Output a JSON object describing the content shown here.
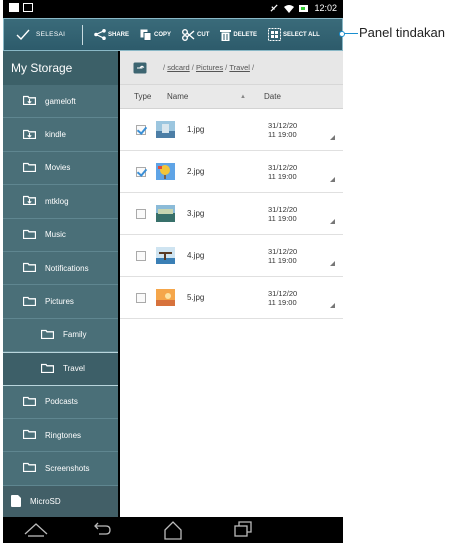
{
  "status_bar": {
    "time": "12:02"
  },
  "action_bar": {
    "done_label": "SELESAI",
    "share_label": "SHARE",
    "copy_label": "COPY",
    "cut_label": "CUT",
    "delete_label": "DELETE",
    "select_all_label": "SELECT ALL"
  },
  "sidebar": {
    "title": "My Storage",
    "items": [
      {
        "label": "gameloft",
        "icon": "folder-download-icon"
      },
      {
        "label": "kindle",
        "icon": "folder-download-icon"
      },
      {
        "label": "Movies",
        "icon": "folder-icon"
      },
      {
        "label": "mtklog",
        "icon": "folder-download-icon"
      },
      {
        "label": "Music",
        "icon": "folder-icon"
      },
      {
        "label": "Notifications",
        "icon": "folder-icon"
      },
      {
        "label": "Pictures",
        "icon": "folder-icon"
      },
      {
        "label": "Family",
        "icon": "folder-icon"
      },
      {
        "label": "Travel",
        "icon": "folder-icon"
      },
      {
        "label": "Podcasts",
        "icon": "folder-icon"
      },
      {
        "label": "Ringtones",
        "icon": "folder-icon"
      },
      {
        "label": "Screenshots",
        "icon": "folder-icon"
      },
      {
        "label": "MicroSD",
        "icon": "sdcard-icon"
      }
    ]
  },
  "path": {
    "root": "/",
    "sdcard": "sdcard",
    "sep1": "/",
    "pictures": "Pictures",
    "sep2": "/",
    "travel": "Travel",
    "end": "/"
  },
  "columns": {
    "type": "Type",
    "name": "Name",
    "date": "Date"
  },
  "files": [
    {
      "name": "1.jpg",
      "date1": "31/12/20",
      "date2": "11 19:00",
      "checked": true
    },
    {
      "name": "2.jpg",
      "date1": "31/12/20",
      "date2": "11 19:00",
      "checked": true
    },
    {
      "name": "3.jpg",
      "date1": "31/12/20",
      "date2": "11 19:00",
      "checked": false
    },
    {
      "name": "4.jpg",
      "date1": "31/12/20",
      "date2": "11 19:00",
      "checked": false
    },
    {
      "name": "5.jpg",
      "date1": "31/12/20",
      "date2": "11 19:00",
      "checked": false
    }
  ],
  "callout": {
    "label": "Panel tindakan"
  },
  "colors": {
    "accent": "#2d5b6b",
    "sidebar": "#4a6f78",
    "check": "#3a8fd6",
    "callout": "#1a8fd0"
  }
}
